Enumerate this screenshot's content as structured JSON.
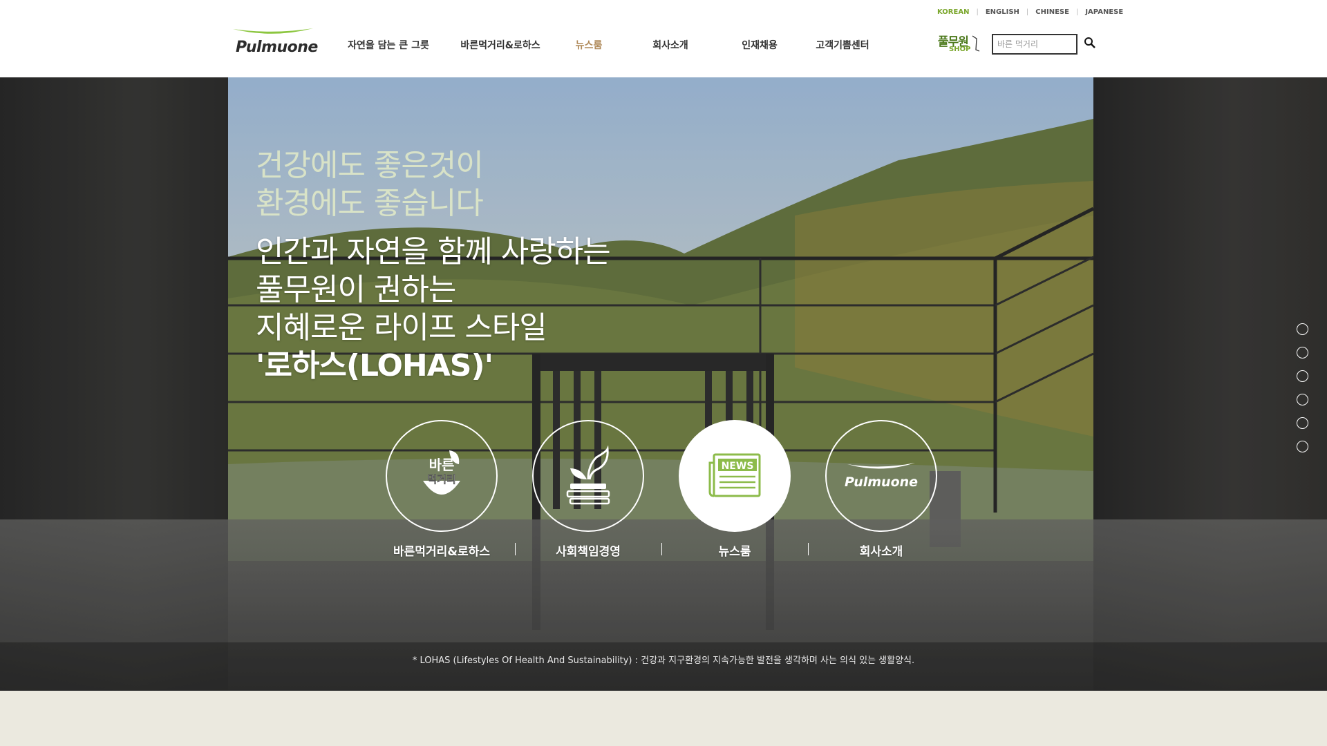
{
  "languages": [
    {
      "label": "KOREAN",
      "active": true
    },
    {
      "label": "ENGLISH",
      "active": false
    },
    {
      "label": "CHINESE",
      "active": false
    },
    {
      "label": "JAPANESE",
      "active": false
    }
  ],
  "logo": {
    "text": "Pulmuone"
  },
  "nav": [
    {
      "label": "자연을 담는 큰 그릇",
      "active": false
    },
    {
      "label": "바른먹거리&로하스",
      "active": false
    },
    {
      "label": "뉴스룸",
      "active": true
    },
    {
      "label": "회사소개",
      "active": false
    },
    {
      "label": "인재채용",
      "active": false
    },
    {
      "label": "고객기쁨센터",
      "active": false
    }
  ],
  "shop": {
    "korean": "풀무원",
    "english": "SHOP",
    "icon": "shop-bag-icon"
  },
  "search": {
    "placeholder": "바른 먹거리",
    "value": "",
    "icon": "search-icon"
  },
  "hero": {
    "sub_lines": [
      "건강에도 좋은것이",
      "환경에도 좋습니다"
    ],
    "main_lines": [
      "인간과 자연을 함께 사랑하는",
      "풀무원이 권하는",
      "지혜로운 라이프 스타일"
    ],
    "main_strong": "'로하스(LOHAS)'",
    "quick_links": [
      {
        "label": "바른먹거리&로하스",
        "icon": "healthy-food-icon",
        "icon_text_1": "바른",
        "icon_text_2": "먹거리",
        "active": false
      },
      {
        "label": "사회책임경영",
        "icon": "sprout-books-icon",
        "active": false
      },
      {
        "label": "뉴스룸",
        "icon": "newspaper-icon",
        "icon_text": "NEWS",
        "active": true
      },
      {
        "label": "회사소개",
        "icon": "pulmuone-logo-icon",
        "icon_text": "Pulmuone",
        "active": false
      }
    ],
    "pager_count": 6,
    "footnote": "* LOHAS (Lifestyles Of Health And Sustainability) : 건강과 지구환경의 지속가능한 발전을 생각하며 사는 의식 있는 생활양식."
  },
  "colors": {
    "brand_green": "#7aa62b",
    "active_nav": "#b08a5a",
    "bottom_band": "#ebe9df"
  }
}
